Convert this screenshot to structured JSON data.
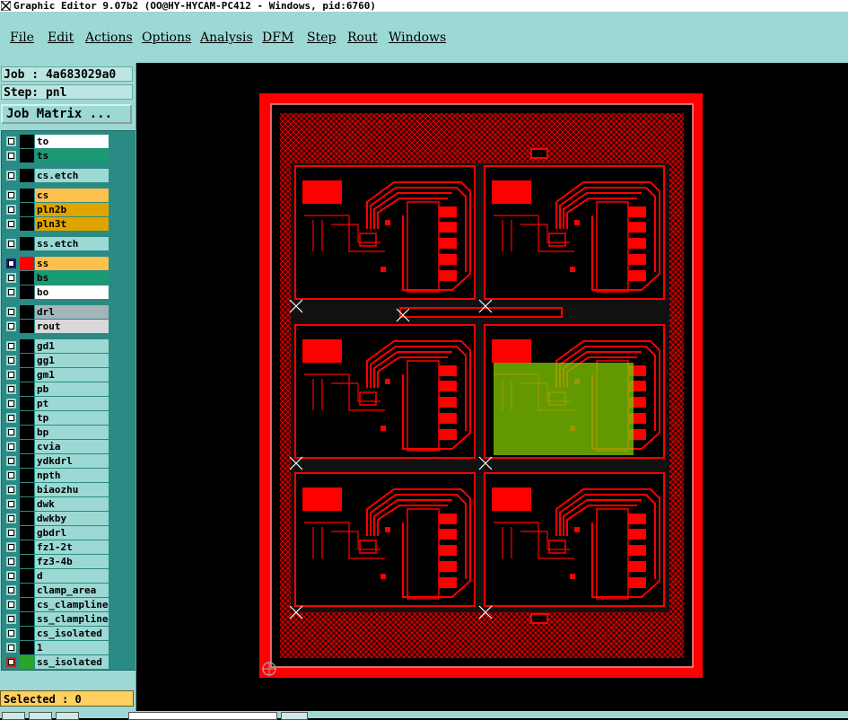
{
  "window": {
    "title": "Graphic Editor 9.07b2 (OO@HY-HYCAM-PC412 - Windows, pid:6760)"
  },
  "menu": [
    "File",
    "Edit",
    "Actions",
    "Options",
    "Analysis",
    "DFM",
    "Step",
    "Rout",
    "Windows"
  ],
  "job": {
    "job_label": "Job : 4a683029a0",
    "step_label": "Step: pnl",
    "matrix_button": "Job Matrix ..."
  },
  "layers": [
    {
      "name": "to",
      "color": "#ffffff"
    },
    {
      "name": "ts",
      "color": "#1a9a73"
    },
    {
      "name": "cs.etch",
      "color": "#9cd9d4"
    },
    {
      "name": "cs",
      "color": "#ffc14d"
    },
    {
      "name": "pln2b",
      "color": "#e0a400"
    },
    {
      "name": "pln3t",
      "color": "#e0a400"
    },
    {
      "name": "ss.etch",
      "color": "#9cd9d4"
    },
    {
      "name": "ss",
      "color": "#ffc14d"
    },
    {
      "name": "bs",
      "color": "#1a9a73"
    },
    {
      "name": "bo",
      "color": "#ffffff"
    },
    {
      "name": "drl",
      "color": "#a3b5b8"
    },
    {
      "name": "rout",
      "color": "#d9d9d9"
    },
    {
      "name": "gd1",
      "color": "#9cd9d4"
    },
    {
      "name": "gg1",
      "color": "#9cd9d4"
    },
    {
      "name": "gm1",
      "color": "#9cd9d4"
    },
    {
      "name": "pb",
      "color": "#9cd9d4"
    },
    {
      "name": "pt",
      "color": "#9cd9d4"
    },
    {
      "name": "tp",
      "color": "#9cd9d4"
    },
    {
      "name": "bp",
      "color": "#9cd9d4"
    },
    {
      "name": "cvia",
      "color": "#9cd9d4"
    },
    {
      "name": "ydkdrl",
      "color": "#9cd9d4"
    },
    {
      "name": "npth",
      "color": "#9cd9d4"
    },
    {
      "name": "biaozhu",
      "color": "#9cd9d4"
    },
    {
      "name": "dwk",
      "color": "#9cd9d4"
    },
    {
      "name": "dwkby",
      "color": "#9cd9d4"
    },
    {
      "name": "gbdrl",
      "color": "#9cd9d4"
    },
    {
      "name": "fz1-2t",
      "color": "#9cd9d4"
    },
    {
      "name": "fz3-4b",
      "color": "#9cd9d4"
    },
    {
      "name": "d",
      "color": "#9cd9d4"
    },
    {
      "name": "clamp_area",
      "color": "#9cd9d4"
    },
    {
      "name": "cs_clampline",
      "color": "#9cd9d4"
    },
    {
      "name": "ss_clampline",
      "color": "#9cd9d4"
    },
    {
      "name": "cs_isolated",
      "color": "#9cd9d4"
    },
    {
      "name": "1",
      "color": "#9cd9d4"
    },
    {
      "name": "ss_isolated",
      "color": "#9cd9d4"
    }
  ],
  "status": {
    "selected": "Selected : 0"
  },
  "colors": {
    "panel": "#9cd9d4",
    "board": "#ff0000",
    "highlight": "#7fc400"
  }
}
